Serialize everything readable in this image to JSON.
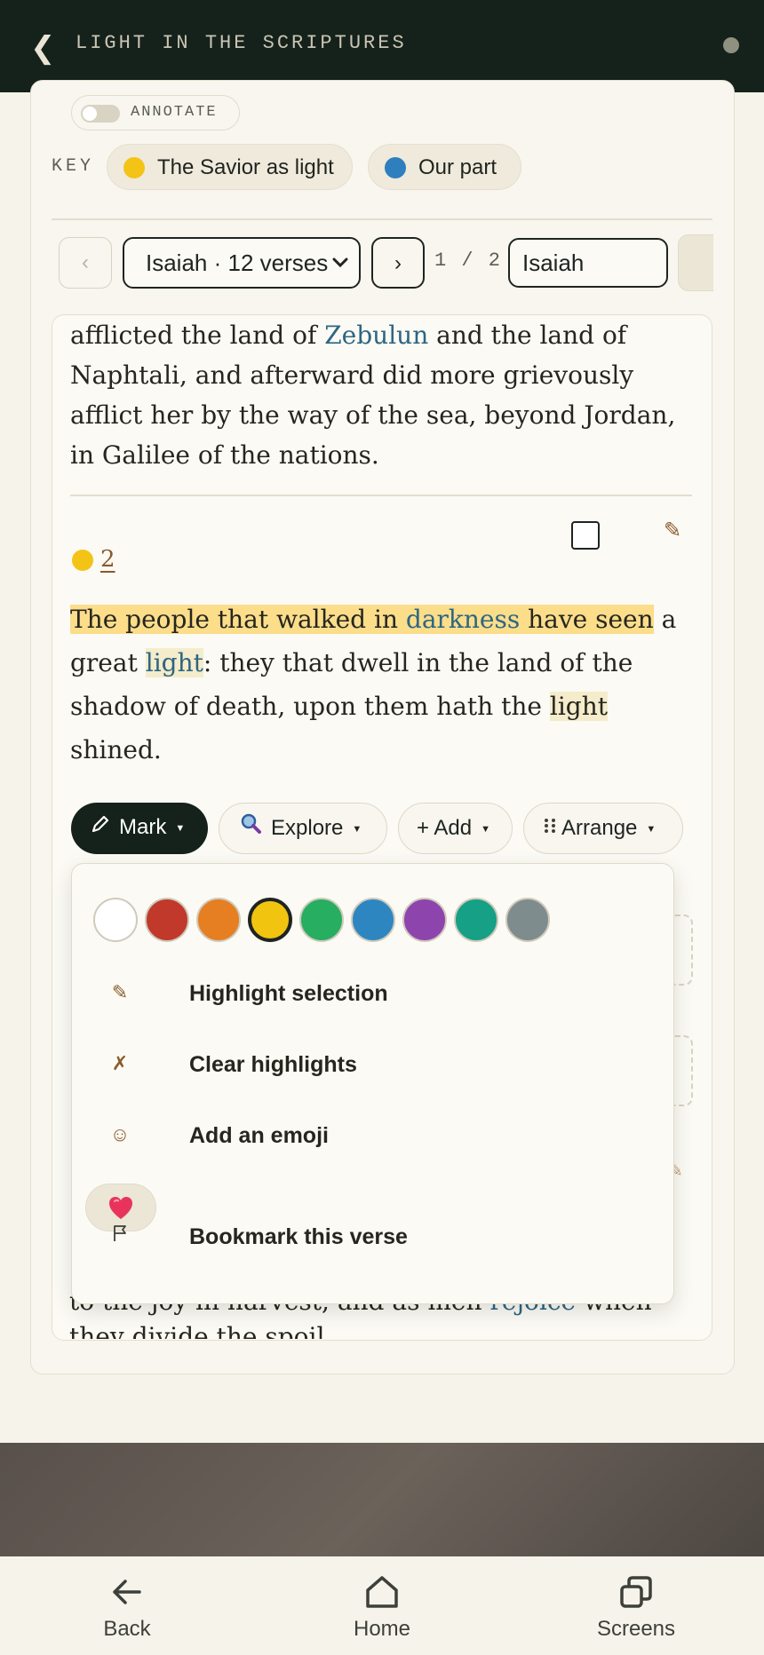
{
  "header": {
    "title": "LIGHT IN THE SCRIPTURES",
    "back_icon": "chevron-left-icon"
  },
  "annotate": {
    "label": "ANNOTATE",
    "enabled": false
  },
  "key": {
    "label": "KEY",
    "items": [
      {
        "label": "The Savior as light",
        "color": "#f3c416"
      },
      {
        "label": "Our part",
        "color": "#2f7fbf"
      }
    ]
  },
  "nav": {
    "prev": "‹",
    "next": "›",
    "book_select": "Isaiah · 12 verses",
    "page_indicator": "1 / 2",
    "search_value": "Isaiah"
  },
  "verse1": {
    "t1": "afflicted the land of ",
    "link1": "Zebulun",
    "t2": " and the land of Naphtali, and afterward did more grievously afflict her by the way of the sea, beyond Jordan, in Galilee of the nations."
  },
  "verse2": {
    "number": "2",
    "hl1": "The people that walked in ",
    "hl_link": "darkness",
    "hl2": " have seen",
    "t1": " a great ",
    "link_light": "light",
    "t2": ": they that dwell in the land of the shadow of death, upon them hath the ",
    "light2": "light",
    "t3": " shined."
  },
  "toolbar": {
    "mark": "Mark",
    "explore": "Explore",
    "add": "+ Add",
    "arrange": "Arrange"
  },
  "mark_menu": {
    "swatches": [
      "#ffffff",
      "#c0392b",
      "#e67e22",
      "#f1c40f",
      "#27ae60",
      "#2e86c1",
      "#8e44ad",
      "#16a085",
      "#7f8c8d"
    ],
    "selected_swatch": "#f1c40f",
    "highlight": "Highlight selection",
    "clear": "Clear highlights",
    "emoji": "Add an emoji",
    "bookmark": "Bookmark this verse"
  },
  "verse3_fragment": {
    "t1": "to the joy in harvest, and as men ",
    "link": "rejoice",
    "t2": " when",
    "line2": "they divide the spoil."
  },
  "bottom_nav": {
    "back": "Back",
    "home": "Home",
    "screens": "Screens"
  }
}
